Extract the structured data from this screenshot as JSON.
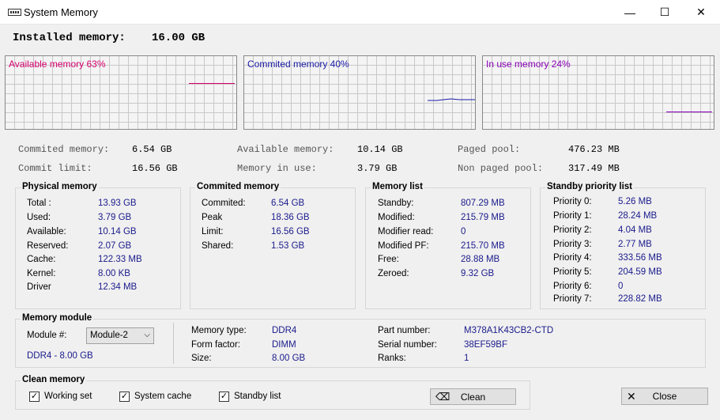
{
  "window": {
    "title": "System Memory",
    "minimize_glyph": "—",
    "maximize_glyph": "☐",
    "close_glyph": "✕"
  },
  "installed": {
    "label": "Installed memory:",
    "value": "16.00 GB"
  },
  "graphs": [
    {
      "label": "Available memory 63%",
      "color": "#d6006e",
      "percent": 63
    },
    {
      "label": "Commited memory 40%",
      "color": "#1a1aa6",
      "percent": 40
    },
    {
      "label": "In use memory 24%",
      "color": "#8a00b8",
      "percent": 24
    }
  ],
  "summary": {
    "commited_label": "Commited memory:",
    "commited_value": "6.54 GB",
    "limit_label": "Commit limit:",
    "limit_value": "16.56 GB",
    "available_label": "Available memory:",
    "available_value": "10.14 GB",
    "inuse_label": "Memory in use:",
    "inuse_value": "3.79 GB",
    "paged_label": "Paged pool:",
    "paged_value": "476.23 MB",
    "nonpaged_label": "Non paged pool:",
    "nonpaged_value": "317.49 MB"
  },
  "physical": {
    "title": "Physical memory",
    "rows": [
      {
        "label": "Total :",
        "value": "13.93 GB"
      },
      {
        "label": "Used:",
        "value": "3.79 GB"
      },
      {
        "label": "Available:",
        "value": "10.14 GB"
      },
      {
        "label": "Reserved:",
        "value": "2.07 GB"
      },
      {
        "label": "Cache:",
        "value": "122.33 MB"
      },
      {
        "label": "Kernel:",
        "value": "8.00 KB"
      },
      {
        "label": "Driver",
        "value": "12.34 MB"
      }
    ]
  },
  "commited": {
    "title": "Commited memory",
    "rows": [
      {
        "label": "Commited:",
        "value": "6.54 GB"
      },
      {
        "label": "Peak",
        "value": "18.36 GB"
      },
      {
        "label": "Limit:",
        "value": "16.56 GB"
      },
      {
        "label": "Shared:",
        "value": "1.53 GB"
      }
    ]
  },
  "memlist": {
    "title": "Memory list",
    "rows": [
      {
        "label": "Standby:",
        "value": "807.29 MB"
      },
      {
        "label": "Modified:",
        "value": "215.79 MB"
      },
      {
        "label": "Modifier read:",
        "value": "0"
      },
      {
        "label": "Modified PF:",
        "value": "215.70 MB"
      },
      {
        "label": "Free:",
        "value": "28.88 MB"
      },
      {
        "label": "Zeroed:",
        "value": "9.32 GB"
      }
    ]
  },
  "standby": {
    "title": "Standby priority list",
    "rows": [
      {
        "label": "Priority 0:",
        "value": "5.26 MB"
      },
      {
        "label": "Priority 1:",
        "value": "28.24 MB"
      },
      {
        "label": "Priority 2:",
        "value": "4.04 MB"
      },
      {
        "label": "Priority 3:",
        "value": "2.77 MB"
      },
      {
        "label": "Priority 4:",
        "value": "333.56 MB"
      },
      {
        "label": "Priority 5:",
        "value": "204.59 MB"
      },
      {
        "label": "Priority 6:",
        "value": "0"
      },
      {
        "label": "Priority 7:",
        "value": "228.82 MB"
      }
    ]
  },
  "module": {
    "title": "Memory module",
    "select_label": "Module #:",
    "selected": "Module-2",
    "summary": "DDR4 - 8.00 GB",
    "type_label": "Memory type:",
    "type_value": "DDR4",
    "form_label": "Form factor:",
    "form_value": "DIMM",
    "size_label": "Size:",
    "size_value": "8.00 GB",
    "part_label": "Part number:",
    "part_value": "M378A1K43CB2-CTD",
    "serial_label": "Serial number:",
    "serial_value": "38EF59BF",
    "ranks_label": "Ranks:",
    "ranks_value": "1"
  },
  "clean": {
    "title": "Clean memory",
    "working_set": "Working set",
    "system_cache": "System cache",
    "standby_list": "Standby list",
    "check_glyph": "✓",
    "clean_button": "Clean",
    "clean_icon_glyph": "⌫"
  },
  "close_button": "Close",
  "close_icon_glyph": "✕"
}
